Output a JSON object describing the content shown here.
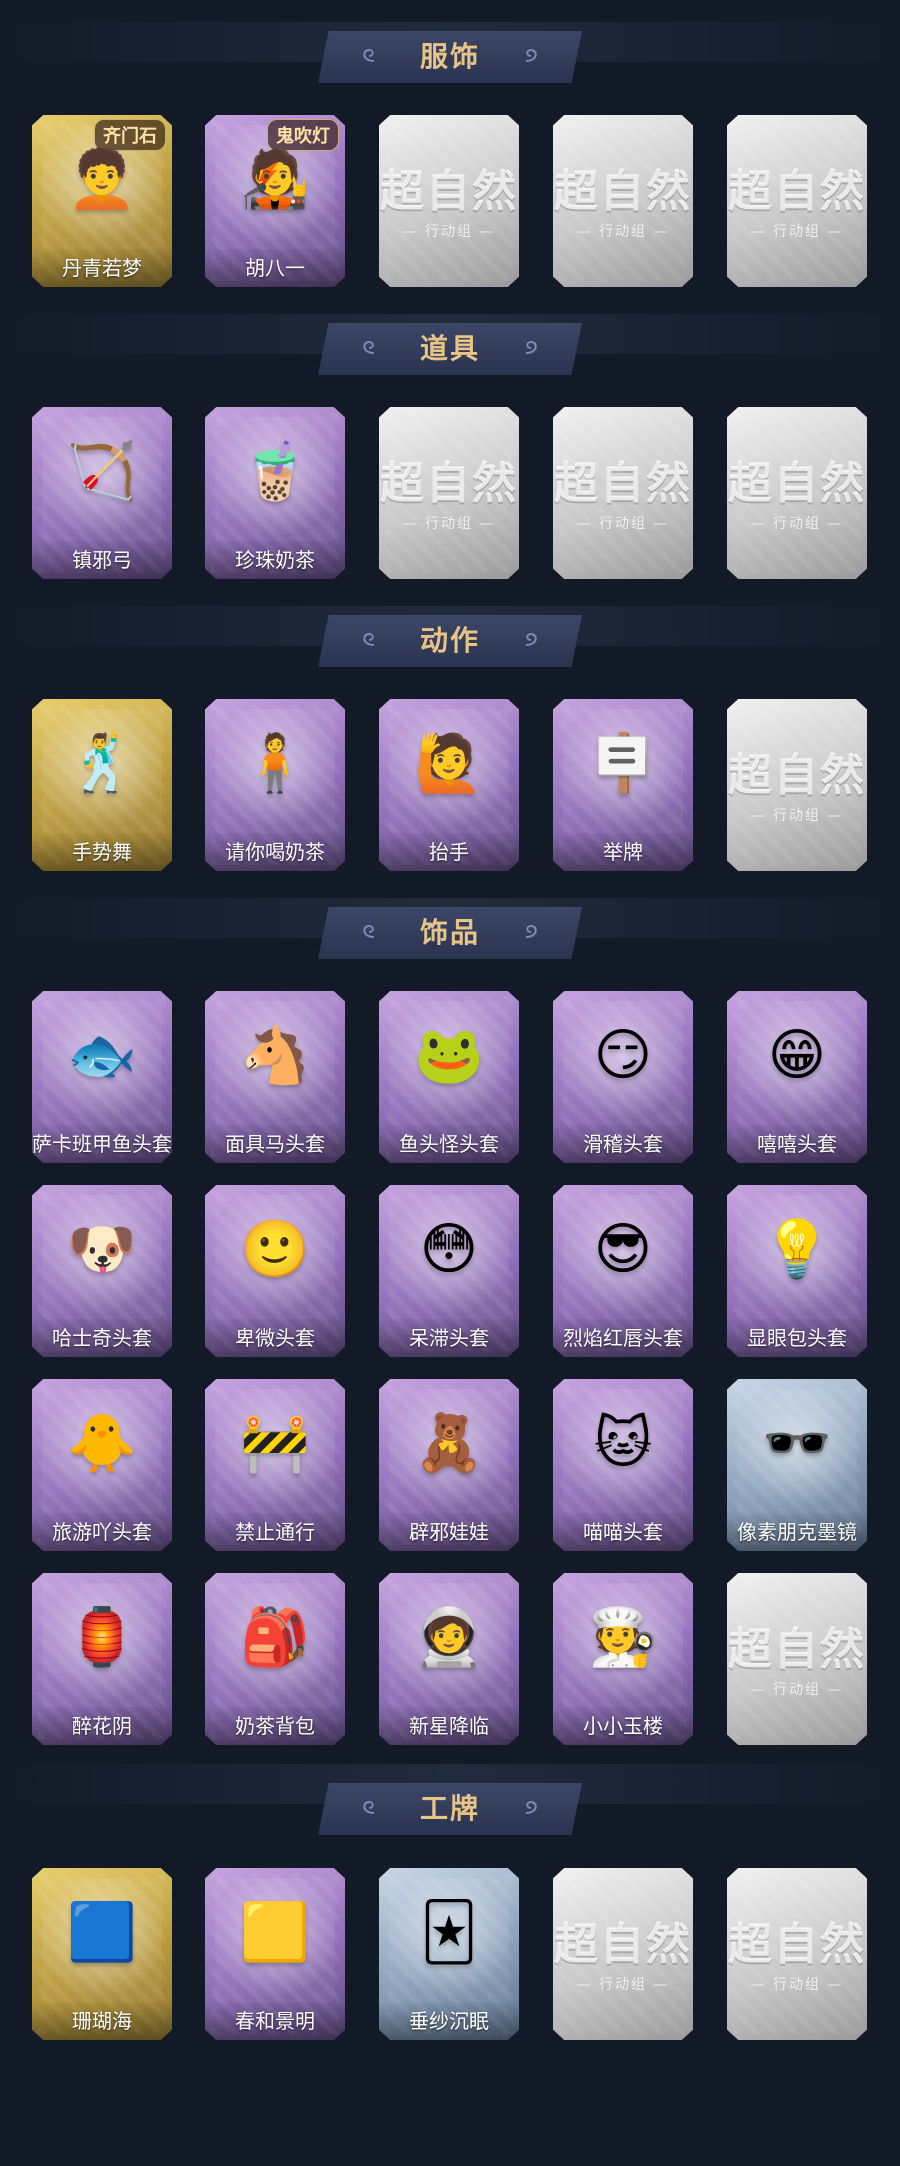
{
  "sections": [
    {
      "title": "服饰",
      "items": [
        {
          "label": "丹青若梦",
          "rarity": "gold",
          "art": "🧑‍🦱",
          "badge": "齐门石"
        },
        {
          "label": "胡八一",
          "rarity": "purple",
          "art": "🧑‍🎤",
          "badge": "鬼吹灯"
        },
        {
          "locked": true
        },
        {
          "locked": true
        },
        {
          "locked": true
        }
      ]
    },
    {
      "title": "道具",
      "items": [
        {
          "label": "镇邪弓",
          "rarity": "purple",
          "art": "🏹"
        },
        {
          "label": "珍珠奶茶",
          "rarity": "purple",
          "art": "🧋"
        },
        {
          "locked": true
        },
        {
          "locked": true
        },
        {
          "locked": true
        }
      ]
    },
    {
      "title": "动作",
      "items": [
        {
          "label": "手势舞",
          "rarity": "gold",
          "art": "🕺"
        },
        {
          "label": "请你喝奶茶",
          "rarity": "purple",
          "art": "🧍"
        },
        {
          "label": "抬手",
          "rarity": "purple",
          "art": "🙋"
        },
        {
          "label": "举牌",
          "rarity": "purple",
          "art": "🪧"
        },
        {
          "locked": true
        }
      ]
    },
    {
      "title": "饰品",
      "items": [
        {
          "label": "萨卡班甲鱼头套",
          "rarity": "purple",
          "art": "🐟"
        },
        {
          "label": "面具马头套",
          "rarity": "purple",
          "art": "🐴"
        },
        {
          "label": "鱼头怪头套",
          "rarity": "purple",
          "art": "🐸"
        },
        {
          "label": "滑稽头套",
          "rarity": "purple",
          "art": "😏"
        },
        {
          "label": "嘻嘻头套",
          "rarity": "purple",
          "art": "😁"
        },
        {
          "label": "哈士奇头套",
          "rarity": "purple",
          "art": "🐶"
        },
        {
          "label": "卑微头套",
          "rarity": "purple",
          "art": "🙂"
        },
        {
          "label": "呆滞头套",
          "rarity": "purple",
          "art": "😳"
        },
        {
          "label": "烈焰红唇头套",
          "rarity": "purple",
          "art": "😎"
        },
        {
          "label": "显眼包头套",
          "rarity": "purple",
          "art": "💡"
        },
        {
          "label": "旅游吖头套",
          "rarity": "purple",
          "art": "🐥"
        },
        {
          "label": "禁止通行",
          "rarity": "purple",
          "art": "🚧"
        },
        {
          "label": "辟邪娃娃",
          "rarity": "purple",
          "art": "🧸"
        },
        {
          "label": "喵喵头套",
          "rarity": "purple",
          "art": "🐱"
        },
        {
          "label": "像素朋克墨镜",
          "rarity": "blue",
          "art": "🕶️"
        },
        {
          "label": "醉花阴",
          "rarity": "purple",
          "art": "🏮"
        },
        {
          "label": "奶茶背包",
          "rarity": "purple",
          "art": "🎒"
        },
        {
          "label": "新星降临",
          "rarity": "purple",
          "art": "🧑‍🚀"
        },
        {
          "label": "小小玉楼",
          "rarity": "purple",
          "art": "🧑‍🍳"
        },
        {
          "locked": true
        }
      ]
    },
    {
      "title": "工牌",
      "items": [
        {
          "label": "珊瑚海",
          "rarity": "gold",
          "art": "🟦"
        },
        {
          "label": "春和景明",
          "rarity": "purple",
          "art": "🟨"
        },
        {
          "label": "垂纱沉眠",
          "rarity": "blue",
          "art": "🃏"
        },
        {
          "locked": true
        },
        {
          "locked": true
        }
      ]
    }
  ],
  "locked_card": {
    "big_text": "超自然",
    "small_text": "— 行动组 —"
  },
  "colors": {
    "background": "#121a27",
    "header_gold": "#e9c487"
  }
}
